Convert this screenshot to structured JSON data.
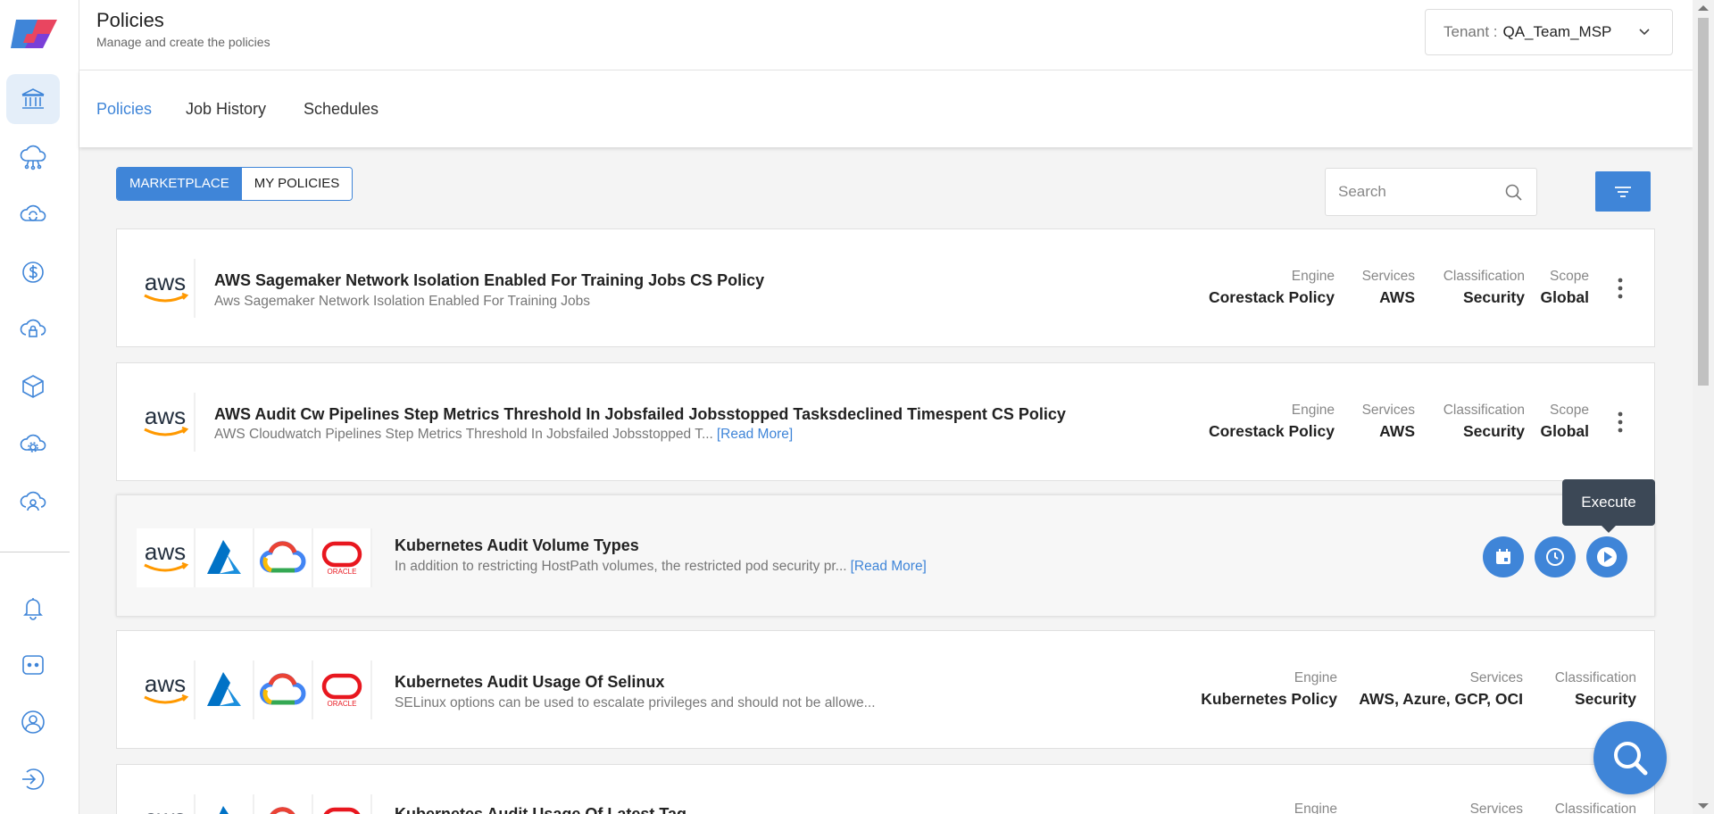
{
  "header": {
    "title": "Policies",
    "subtitle": "Manage and create the policies",
    "tenant_label": "Tenant :",
    "tenant_value": "QA_Team_MSP"
  },
  "tabs": [
    {
      "label": "Policies",
      "active": true
    },
    {
      "label": "Job History",
      "active": false
    },
    {
      "label": "Schedules",
      "active": false
    }
  ],
  "toggle": {
    "marketplace": "MARKETPLACE",
    "my_policies": "MY POLICIES"
  },
  "search": {
    "placeholder": "Search"
  },
  "sidebar": {
    "items": [
      "bank-icon",
      "cloud-network-icon",
      "cloud-sync-icon",
      "dollar-icon",
      "cloud-lock-icon",
      "cube-icon",
      "cloud-gear-icon",
      "cloud-user-icon"
    ],
    "bottom": [
      "bell-icon",
      "chat-icon",
      "user-icon",
      "logout-icon"
    ]
  },
  "read_more": "[Read More]",
  "tooltip": "Execute",
  "policies": [
    {
      "name": "AWS Sagemaker Network Isolation Enabled For Training Jobs CS Policy",
      "description": "Aws Sagemaker Network Isolation Enabled For Training Jobs",
      "providers": [
        "aws"
      ],
      "engine_label": "Engine",
      "engine": "Corestack Policy",
      "services_label": "Services",
      "services": "AWS",
      "classification_label": "Classification",
      "classification": "Security",
      "scope_label": "Scope",
      "scope": "Global"
    },
    {
      "name": "AWS Audit Cw Pipelines Step Metrics Threshold In Jobsfailed Jobsstopped Tasksdeclined Timespent CS Policy",
      "description": "AWS Cloudwatch Pipelines Step Metrics Threshold In Jobsfailed Jobsstopped T...",
      "providers": [
        "aws"
      ],
      "engine_label": "Engine",
      "engine": "Corestack Policy",
      "services_label": "Services",
      "services": "AWS",
      "classification_label": "Classification",
      "classification": "Security",
      "scope_label": "Scope",
      "scope": "Global"
    },
    {
      "name": "Kubernetes Audit Volume Types",
      "description": "In addition to restricting HostPath volumes, the restricted pod security pr...",
      "providers": [
        "aws",
        "azure",
        "gcp",
        "oracle"
      ]
    },
    {
      "name": "Kubernetes Audit Usage Of Selinux",
      "description": "SELinux options can be used to escalate privileges and should not be allowe...",
      "providers": [
        "aws",
        "azure",
        "gcp",
        "oracle"
      ],
      "engine_label": "Engine",
      "engine": "Kubernetes Policy",
      "services_label": "Services",
      "services": "AWS, Azure, GCP, OCI",
      "classification_label": "Classification",
      "classification": "Security"
    },
    {
      "name": "Kubernetes Audit Usage Of Latest Tag",
      "providers": [
        "aws",
        "azure",
        "gcp",
        "oracle"
      ],
      "engine_label": "Engine",
      "services_label": "Services",
      "classification_label": "Classification"
    }
  ],
  "colors": {
    "accent": "#3f85d8",
    "tooltip_bg": "#3c4856"
  }
}
